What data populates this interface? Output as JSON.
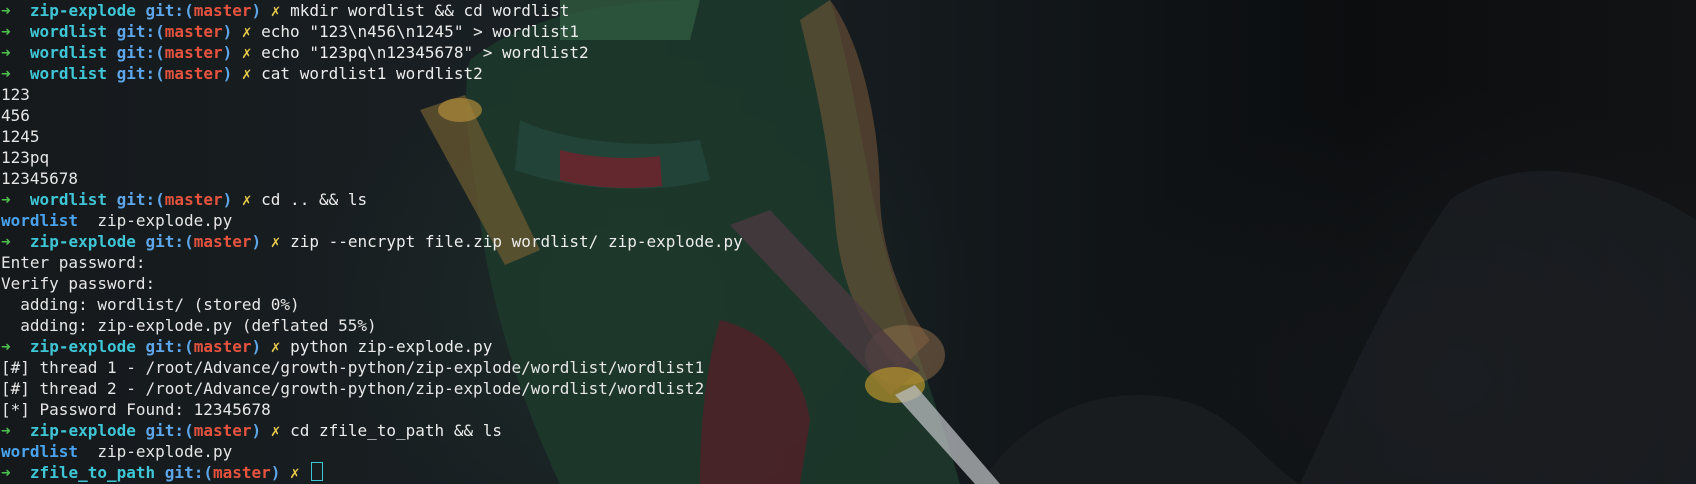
{
  "prompt": {
    "arrow": "➜",
    "git_prefix": "git:(",
    "branch": "master",
    "git_suffix": ")",
    "dirty_mark": "✗"
  },
  "lines": [
    {
      "kind": "prompt",
      "dir": "zip-explode",
      "cmd": "mkdir wordlist && cd wordlist"
    },
    {
      "kind": "prompt",
      "dir": "wordlist",
      "cmd": "echo \"123\\n456\\n1245\" > wordlist1"
    },
    {
      "kind": "prompt",
      "dir": "wordlist",
      "cmd": "echo \"123pq\\n12345678\" > wordlist2"
    },
    {
      "kind": "prompt",
      "dir": "wordlist",
      "cmd": "cat wordlist1 wordlist2"
    },
    {
      "kind": "output",
      "text": "123"
    },
    {
      "kind": "output",
      "text": "456"
    },
    {
      "kind": "output",
      "text": "1245"
    },
    {
      "kind": "output",
      "text": "123pq"
    },
    {
      "kind": "output",
      "text": "12345678"
    },
    {
      "kind": "prompt",
      "dir": "wordlist",
      "cmd": "cd .. && ls"
    },
    {
      "kind": "ls",
      "dir_entry": "wordlist",
      "file_entry": "zip-explode.py"
    },
    {
      "kind": "prompt",
      "dir": "zip-explode",
      "cmd": "zip --encrypt file.zip wordlist/ zip-explode.py"
    },
    {
      "kind": "output",
      "text": "Enter password:"
    },
    {
      "kind": "output",
      "text": "Verify password:"
    },
    {
      "kind": "output",
      "text": "  adding: wordlist/ (stored 0%)"
    },
    {
      "kind": "output",
      "text": "  adding: zip-explode.py (deflated 55%)"
    },
    {
      "kind": "prompt",
      "dir": "zip-explode",
      "cmd": "python zip-explode.py"
    },
    {
      "kind": "output",
      "text": "[#] thread 1 - /root/Advance/growth-python/zip-explode/wordlist/wordlist1"
    },
    {
      "kind": "output",
      "text": "[#] thread 2 - /root/Advance/growth-python/zip-explode/wordlist/wordlist2"
    },
    {
      "kind": "output",
      "text": "[*] Password Found: 12345678"
    },
    {
      "kind": "prompt",
      "dir": "zip-explode",
      "cmd": "cd zfile_to_path && ls"
    },
    {
      "kind": "ls",
      "dir_entry": "wordlist",
      "file_entry": "zip-explode.py"
    },
    {
      "kind": "active",
      "dir": "zfile_to_path",
      "cmd": ""
    }
  ],
  "colors": {
    "arrow": "#4ec24f",
    "dir": "#3fc6d6",
    "git": "#5ea6ea",
    "branch": "#e5533f",
    "dirty": "#e6c84a",
    "ls_dir": "#4aa3ee"
  }
}
